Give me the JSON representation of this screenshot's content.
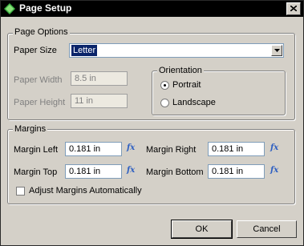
{
  "window": {
    "title": "Page Setup",
    "close_glyph": "×"
  },
  "page_options": {
    "legend": "Page Options",
    "paper_size_label": "Paper Size",
    "paper_size_value": "Letter",
    "paper_width_label": "Paper Width",
    "paper_width_value": "8.5 in",
    "paper_height_label": "Paper Height",
    "paper_height_value": "11 in",
    "orientation": {
      "legend": "Orientation",
      "portrait_label": "Portrait",
      "landscape_label": "Landscape",
      "selected": "Portrait"
    }
  },
  "margins": {
    "legend": "Margins",
    "left_label": "Margin Left",
    "left_value": "0.181 in",
    "right_label": "Margin Right",
    "right_value": "0.181 in",
    "top_label": "Margin Top",
    "top_value": "0.181 in",
    "bottom_label": "Margin Bottom",
    "bottom_value": "0.181 in",
    "fx_glyph": "fx",
    "auto_label": "Adjust Margins Automatically",
    "auto_checked": false
  },
  "buttons": {
    "ok_label": "OK",
    "cancel_label": "Cancel"
  },
  "colors": {
    "title_bar": "#000000",
    "dialog_bg": "#d4d0c8",
    "fx_icon": "#2e5fc2",
    "selection": "#0a246a"
  }
}
